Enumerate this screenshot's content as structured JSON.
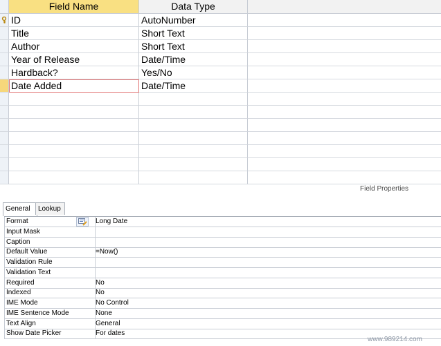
{
  "grid": {
    "headers": {
      "field_name": "Field Name",
      "data_type": "Data Type"
    },
    "rows": [
      {
        "name": "ID",
        "type": "AutoNumber",
        "primary_key": true
      },
      {
        "name": "Title",
        "type": "Short Text"
      },
      {
        "name": "Author",
        "type": "Short Text"
      },
      {
        "name": "Year of Release",
        "type": "Date/Time"
      },
      {
        "name": "Hardback?",
        "type": "Yes/No"
      },
      {
        "name": "Date Added",
        "type": "Date/Time",
        "current": true
      },
      {
        "name": "",
        "type": ""
      },
      {
        "name": "",
        "type": ""
      },
      {
        "name": "",
        "type": ""
      },
      {
        "name": "",
        "type": ""
      },
      {
        "name": "",
        "type": ""
      },
      {
        "name": "",
        "type": ""
      },
      {
        "name": "",
        "type": ""
      }
    ]
  },
  "field_properties": {
    "title": "Field Properties",
    "tabs": [
      "General",
      "Lookup"
    ],
    "active_tab": "General",
    "rows": [
      {
        "label": "Format",
        "value": "Long Date",
        "builder": true
      },
      {
        "label": "Input Mask",
        "value": ""
      },
      {
        "label": "Caption",
        "value": ""
      },
      {
        "label": "Default Value",
        "value": "=Now()"
      },
      {
        "label": "Validation Rule",
        "value": ""
      },
      {
        "label": "Validation Text",
        "value": ""
      },
      {
        "label": "Required",
        "value": "No"
      },
      {
        "label": "Indexed",
        "value": "No"
      },
      {
        "label": "IME Mode",
        "value": "No Control"
      },
      {
        "label": "IME Sentence Mode",
        "value": "None"
      },
      {
        "label": "Text Align",
        "value": "General"
      },
      {
        "label": "Show Date Picker",
        "value": "For dates"
      }
    ]
  },
  "watermark": "www.989214.com",
  "colors": {
    "header_active": "#f9e082",
    "current_border": "#e07070",
    "grid_line": "#c7ccd4"
  },
  "icons": {
    "key": "primary-key-icon",
    "builder": "builder-icon"
  }
}
